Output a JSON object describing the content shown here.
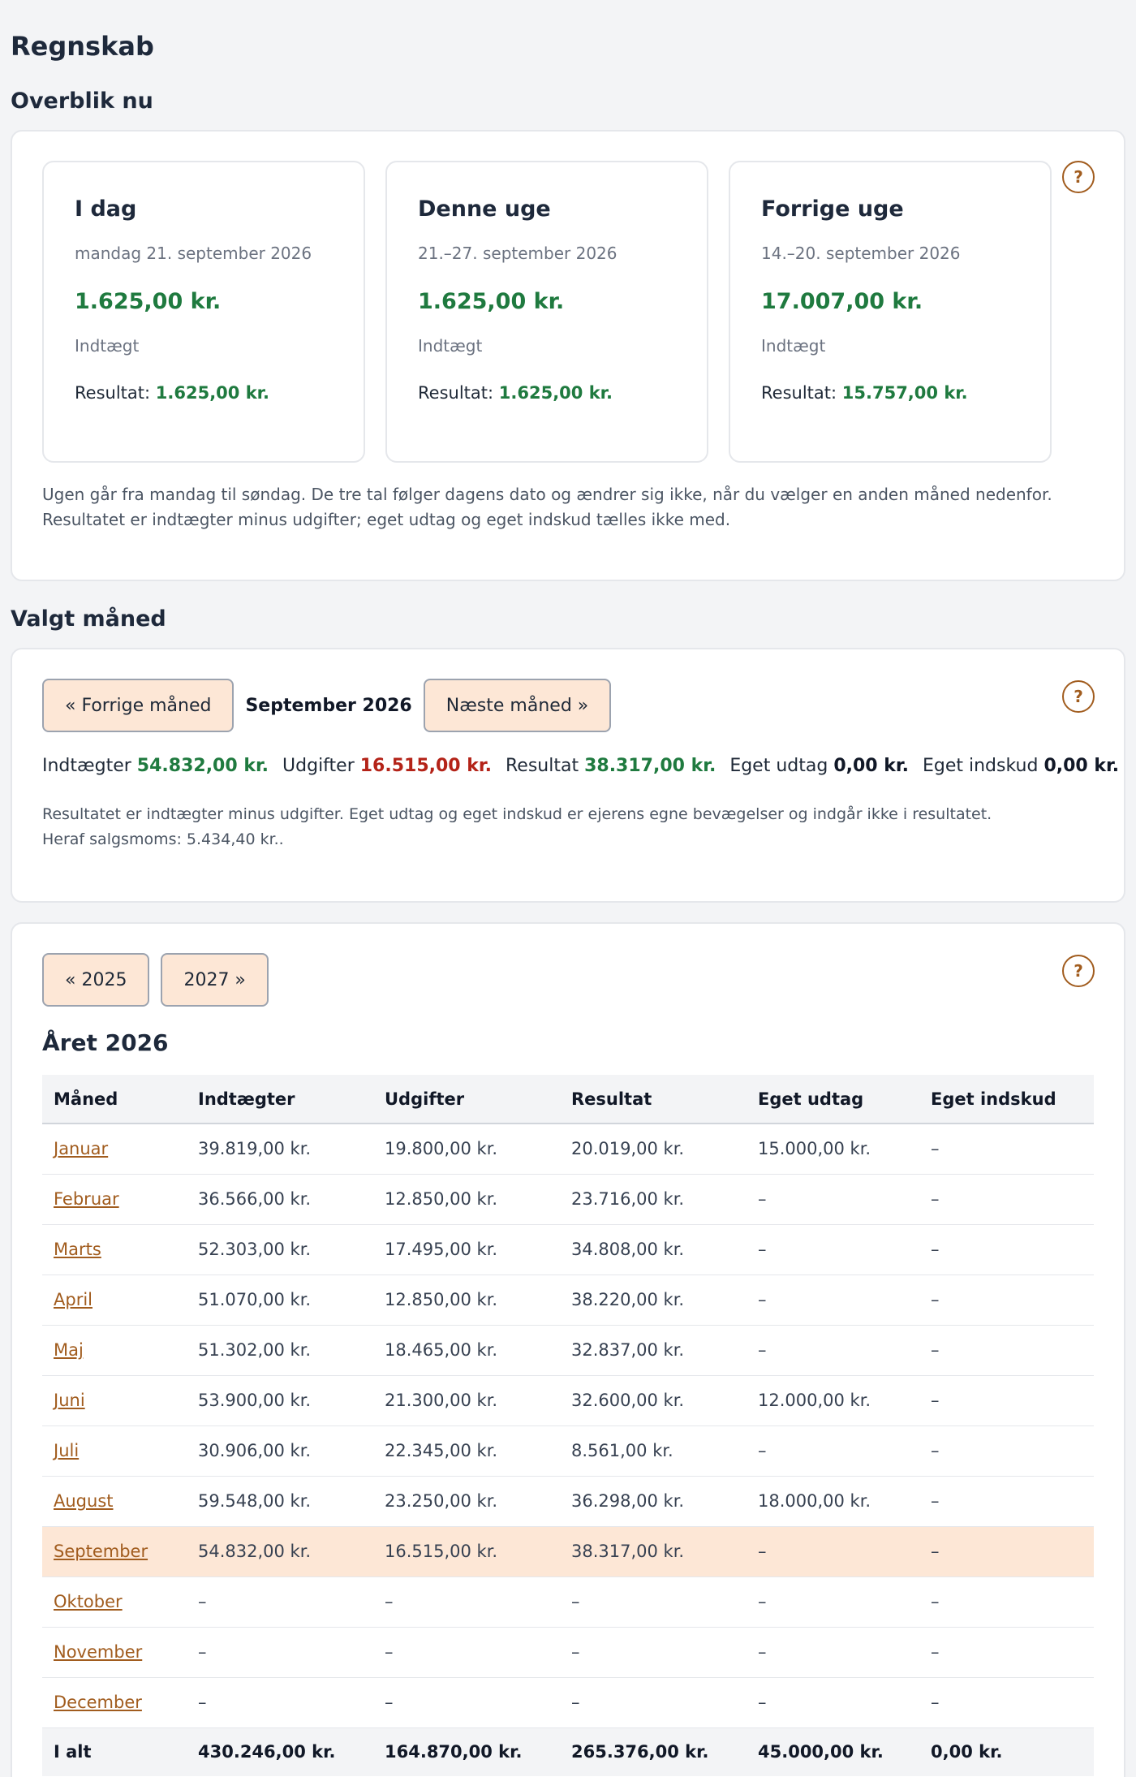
{
  "page_title": "Regnskab",
  "overview": {
    "heading": "Overblik nu",
    "help_label": "?",
    "periods": [
      {
        "title": "I dag",
        "date": "mandag 21. september 2026",
        "amount": "1.625,00 kr.",
        "type": "Indtægt",
        "result_label": "Resultat:",
        "result_value": "1.625,00 kr."
      },
      {
        "title": "Denne uge",
        "date": "21.–27. september 2026",
        "amount": "1.625,00 kr.",
        "type": "Indtægt",
        "result_label": "Resultat:",
        "result_value": "1.625,00 kr."
      },
      {
        "title": "Forrige uge",
        "date": "14.–20. september 2026",
        "amount": "17.007,00 kr.",
        "type": "Indtægt",
        "result_label": "Resultat:",
        "result_value": "15.757,00 kr."
      }
    ],
    "note": "Ugen går fra mandag til søndag. De tre tal følger dagens dato og ændrer sig ikke, når du vælger en anden måned nedenfor. Resultatet er indtægter minus udgifter; eget udtag og eget indskud tælles ikke med."
  },
  "month": {
    "heading": "Valgt måned",
    "help_label": "?",
    "prev_label": "« Forrige måned",
    "current_label": "September 2026",
    "next_label": "Næste måned »",
    "summary": {
      "income_label": "Indtægter",
      "income_value": "54.832,00 kr.",
      "expense_label": "Udgifter",
      "expense_value": "16.515,00 kr.",
      "result_label": "Resultat",
      "result_value": "38.317,00 kr.",
      "withdrawal_label": "Eget udtag",
      "withdrawal_value": "0,00 kr.",
      "deposit_label": "Eget indskud",
      "deposit_value": "0,00 kr."
    },
    "note": "Resultatet er indtægter minus udgifter. Eget udtag og eget indskud er ejerens egne bevægelser og indgår ikke i resultatet. Heraf salgsmoms: 5.434,40 kr.."
  },
  "year": {
    "help_label": "?",
    "prev_label": "« 2025",
    "next_label": "2027 »",
    "title": "Året 2026",
    "columns": [
      "Måned",
      "Indtægter",
      "Udgifter",
      "Resultat",
      "Eget udtag",
      "Eget indskud"
    ],
    "rows": [
      [
        "Januar",
        "39.819,00 kr.",
        "19.800,00 kr.",
        "20.019,00 kr.",
        "15.000,00 kr.",
        "–"
      ],
      [
        "Februar",
        "36.566,00 kr.",
        "12.850,00 kr.",
        "23.716,00 kr.",
        "–",
        "–"
      ],
      [
        "Marts",
        "52.303,00 kr.",
        "17.495,00 kr.",
        "34.808,00 kr.",
        "–",
        "–"
      ],
      [
        "April",
        "51.070,00 kr.",
        "12.850,00 kr.",
        "38.220,00 kr.",
        "–",
        "–"
      ],
      [
        "Maj",
        "51.302,00 kr.",
        "18.465,00 kr.",
        "32.837,00 kr.",
        "–",
        "–"
      ],
      [
        "Juni",
        "53.900,00 kr.",
        "21.300,00 kr.",
        "32.600,00 kr.",
        "12.000,00 kr.",
        "–"
      ],
      [
        "Juli",
        "30.906,00 kr.",
        "22.345,00 kr.",
        "8.561,00 kr.",
        "–",
        "–"
      ],
      [
        "August",
        "59.548,00 kr.",
        "23.250,00 kr.",
        "36.298,00 kr.",
        "18.000,00 kr.",
        "–"
      ],
      [
        "September",
        "54.832,00 kr.",
        "16.515,00 kr.",
        "38.317,00 kr.",
        "–",
        "–"
      ],
      [
        "Oktober",
        "–",
        "–",
        "–",
        "–",
        "–"
      ],
      [
        "November",
        "–",
        "–",
        "–",
        "–",
        "–"
      ],
      [
        "December",
        "–",
        "–",
        "–",
        "–",
        "–"
      ]
    ],
    "selected_row": 8,
    "total": [
      "I alt",
      "430.246,00 kr.",
      "164.870,00 kr.",
      "265.376,00 kr.",
      "45.000,00 kr.",
      "0,00 kr."
    ]
  },
  "colors": {
    "accent": "#a15c1e",
    "positive": "#1f7a3f",
    "negative": "#b42318",
    "highlight": "#fde7d6"
  }
}
